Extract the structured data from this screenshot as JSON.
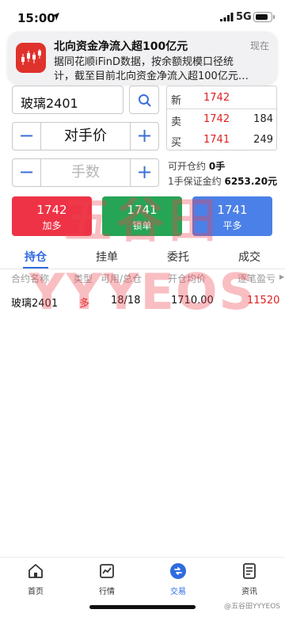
{
  "status_bar": {
    "time": "15:00",
    "network": "5G",
    "icons": [
      "location-arrow-icon",
      "signal-bars-icon",
      "battery-icon"
    ]
  },
  "notification": {
    "title": "北向资金净流入超100亿元",
    "time": "现在",
    "line1": "据同花顺iFinD数据，按余额规模口径统",
    "line2": "计，截至目前北向资金净流入超100亿元…",
    "icon": "candlestick-app-icon"
  },
  "trade_form": {
    "symbol": "玻璃2401",
    "price_mode": "对手价",
    "qty_placeholder": "手数",
    "minus_glyph": "−",
    "plus_glyph": "+"
  },
  "order_book": {
    "rows": [
      {
        "label": "新",
        "price": "1742",
        "volume": ""
      },
      {
        "label": "卖",
        "price": "1742",
        "volume": "184"
      },
      {
        "label": "买",
        "price": "1741",
        "volume": "249"
      }
    ],
    "available_label": "可开仓约",
    "available_value": "0手",
    "margin_label": "1手保证金约",
    "margin_value": "6253.20元"
  },
  "actions": {
    "buy": {
      "price": "1742",
      "label": "加多",
      "color": "#ee3346"
    },
    "lock": {
      "price": "1741",
      "label": "锁单",
      "color": "#27a556"
    },
    "sell": {
      "price": "1741",
      "label": "平多",
      "color": "#4b80e8"
    }
  },
  "tabs": [
    {
      "label": "持仓",
      "active": true
    },
    {
      "label": "挂单",
      "active": false
    },
    {
      "label": "委托",
      "active": false
    },
    {
      "label": "成交",
      "active": false
    }
  ],
  "table": {
    "headers": [
      "合约名称",
      "类型",
      "可用/总仓",
      "开仓均价",
      "逐笔盈亏"
    ],
    "scroll_hint": "▶",
    "rows": [
      {
        "name": "玻璃2401",
        "type": "多",
        "avail_total": "18/18",
        "avg_price": "1710.00",
        "pnl": "11520"
      }
    ]
  },
  "watermark": {
    "cn": "五谷田",
    "en": "YYYEOS"
  },
  "bottom_nav": [
    {
      "label": "首页",
      "icon": "home-icon",
      "active": false
    },
    {
      "label": "行情",
      "icon": "chart-icon",
      "active": false
    },
    {
      "label": "交易",
      "icon": "trade-icon",
      "active": true
    },
    {
      "label": "资讯",
      "icon": "news-icon",
      "active": false
    }
  ],
  "footer_mark": "@五谷田YYYEOS",
  "colors": {
    "accent": "#2f6be0",
    "up": "#e02020",
    "down": "#27a556"
  }
}
